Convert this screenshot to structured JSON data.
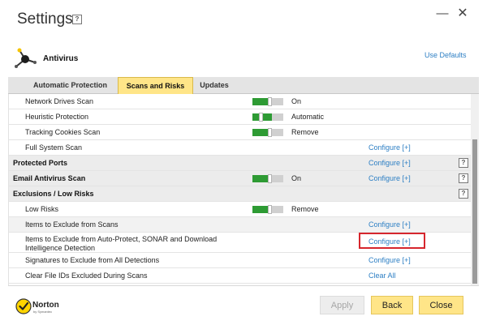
{
  "window": {
    "title": "Settings",
    "help_glyph": "?",
    "minimize_glyph": "—",
    "close_glyph": "✕"
  },
  "section": {
    "label": "Antivirus",
    "icon": "antivirus-satellite-icon",
    "use_defaults": "Use Defaults"
  },
  "tabs": [
    {
      "label": "Automatic Protection",
      "selected": false
    },
    {
      "label": "Scans and Risks",
      "selected": true
    },
    {
      "label": "Updates",
      "selected": false
    }
  ],
  "rows": {
    "network_drives": {
      "label": "Network Drives Scan",
      "value": "On"
    },
    "heuristic": {
      "label": "Heuristic Protection",
      "value": "Automatic"
    },
    "tracking_cookies": {
      "label": "Tracking Cookies Scan",
      "value": "Remove"
    },
    "full_system": {
      "label": "Full System Scan",
      "link": "Configure [+]"
    },
    "protected_ports": {
      "label": "Protected Ports",
      "link": "Configure [+]",
      "help": "?"
    },
    "email_scan": {
      "label": "Email Antivirus Scan",
      "value": "On",
      "link": "Configure [+]",
      "help": "?"
    },
    "exclusions": {
      "label": "Exclusions / Low Risks",
      "help": "?"
    },
    "low_risks": {
      "label": "Low Risks",
      "value": "Remove"
    },
    "items_exclude_scans": {
      "label": "Items to Exclude from Scans",
      "link": "Configure [+]"
    },
    "items_exclude_autoprotect": {
      "label": "Items to Exclude from Auto-Protect, SONAR and Download Intelligence Detection",
      "link": "Configure [+]"
    },
    "signatures_exclude": {
      "label": "Signatures to Exclude from All Detections",
      "link": "Configure [+]"
    },
    "clear_file_ids": {
      "label": "Clear File IDs Excluded During Scans",
      "link": "Clear All"
    }
  },
  "brand": {
    "name": "Norton",
    "sub": "by Symantec",
    "accent": "#ffd400"
  },
  "buttons": {
    "apply": "Apply",
    "back": "Back",
    "close": "Close"
  },
  "colors": {
    "accent_yellow": "#ffe588",
    "toggle_on": "#2e9b34",
    "link": "#2d7fc4",
    "highlight": "#d6262d"
  }
}
